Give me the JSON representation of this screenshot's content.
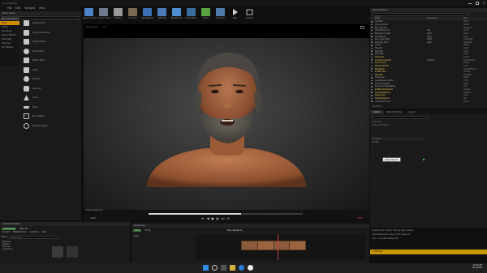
{
  "window": {
    "title": "UnrealEditor"
  },
  "menu": {
    "items": [
      "File",
      "Edit",
      "Window",
      "Help"
    ]
  },
  "toolbar": {
    "buttons": [
      {
        "label": "Save Current",
        "color": "#4a83c9"
      },
      {
        "label": "Source Control",
        "color": "#6d7a8a"
      },
      {
        "label": "Modes",
        "color": "#9a9a9a"
      },
      {
        "label": "Content",
        "color": "#7b6b52"
      },
      {
        "label": "Marketplace",
        "color": "#3b6fb4"
      },
      {
        "label": "Settings",
        "color": "#4c79b8"
      },
      {
        "label": "Blueprints",
        "color": "#4e8fd4"
      },
      {
        "label": "Cinematics",
        "color": "#3a6da0"
      },
      {
        "label": "Build",
        "color": "#5aa33f"
      },
      {
        "label": "Compile",
        "color": "#4d7aa8"
      },
      {
        "label": "Play",
        "color": "#cfcfcf"
      },
      {
        "label": "Launch",
        "color": "#bcbcbc"
      }
    ]
  },
  "place": {
    "tab_label": "Place Actors",
    "recently_placed": "Recently Placed",
    "categories": [
      "Basic",
      "Lights",
      "Cinematic",
      "Visual Effects",
      "Geometry",
      "Volumes",
      "All Classes"
    ],
    "items": [
      "Empty Actor",
      "Empty Character",
      "Empty Pawn",
      "Point Light",
      "Player Start",
      "Cube",
      "Sphere",
      "Cylinder",
      "Cone",
      "Plane",
      "Box Trigger",
      "Sphere Trigger"
    ]
  },
  "viewport": {
    "mode_label": "Perspective",
    "realtime_label": "Lit",
    "footer_label": "Shot_Sequence",
    "timecode_left": "0000",
    "timecode_right": "0000"
  },
  "outliner": {
    "tab_label": "World Outliner",
    "search_placeholder": "Search...",
    "headers": [
      "Label",
      "Sequencer",
      "Type"
    ],
    "rows": [
      {
        "label": "HeadRig",
        "seq": "",
        "type": "World",
        "color": ""
      },
      {
        "label": "Camera_Actor",
        "seq": "",
        "type": "Folder",
        "color": ""
      },
      {
        "label": "BP_Light_Rig",
        "seq": "",
        "type": "Blueprint",
        "color": ""
      },
      {
        "label": "Atmosphere_01",
        "seq": "Sky",
        "type": "Actor",
        "color": ""
      },
      {
        "label": "BackgroundLight",
        "seq": "Light",
        "type": "Actor",
        "color": ""
      },
      {
        "label": "FillLightLeft",
        "seq": "Light",
        "type": "Actor",
        "color": ""
      },
      {
        "label": "Key_Light_Right",
        "seq": "Light",
        "type": "PointLight",
        "color": ""
      },
      {
        "label": "RimLight_Back",
        "seq": "Light",
        "type": "RectLight",
        "color": ""
      },
      {
        "label": "Lights",
        "seq": "",
        "type": "Folder",
        "color": ""
      },
      {
        "label": "FillLight",
        "seq": "",
        "type": "Actor",
        "color": ""
      },
      {
        "label": "KeyLight",
        "seq": "",
        "type": "Actor",
        "color": ""
      },
      {
        "label": "RimLight",
        "seq": "",
        "type": "Actor",
        "color": ""
      },
      {
        "label": "Character",
        "seq": "",
        "type": "Folder",
        "color": "yellow"
      },
      {
        "label": "CineCameraActor",
        "seq": "Camera",
        "type": "CineCamera",
        "color": "yellow"
      },
      {
        "label": "FaceGrooms",
        "seq": "",
        "type": "Folder",
        "color": "yellow"
      },
      {
        "label": "HeadController",
        "seq": "",
        "type": "Actor",
        "color": "yellow"
      },
      {
        "label": "BodyMesh",
        "seq": "",
        "type": "SkeletalMesh",
        "color": "yellow"
      },
      {
        "label": "PostProcess",
        "seq": "",
        "type": "Volume",
        "color": "yellow"
      },
      {
        "label": "SkyLight",
        "seq": "",
        "type": "SkyLight",
        "color": "yellow"
      },
      {
        "label": "Sequencer",
        "seq": "",
        "type": "Folder",
        "color": ""
      },
      {
        "label": "LevelSequenceActor",
        "seq": "",
        "type": "Actor",
        "color": ""
      },
      {
        "label": "DirectionalLight",
        "seq": "",
        "type": "Light",
        "color": ""
      },
      {
        "label": "ExponentialHeightFog",
        "seq": "",
        "type": "Fog",
        "color": ""
      },
      {
        "label": "PostProcessVolume",
        "seq": "",
        "type": "Volume",
        "color": "yellow"
      },
      {
        "label": "SphereReflection",
        "seq": "",
        "type": "Capture",
        "color": "yellow"
      },
      {
        "label": "PlayerStart",
        "seq": "",
        "type": "Actor",
        "color": "yellow"
      },
      {
        "label": "SkyAtmosphere",
        "seq": "",
        "type": "Sky",
        "color": "yellow"
      },
      {
        "label": "VolumetricCloud",
        "seq": "",
        "type": "Cloud",
        "color": ""
      }
    ],
    "footer": "28 actors"
  },
  "details": {
    "tabs": [
      "Details",
      "World Settings",
      "Layers"
    ],
    "tooltip": "Select Parent",
    "label_rows": [
      "Actor Tags",
      "Component Name",
      "Transform"
    ],
    "sub_row": "Mobility"
  },
  "console": {
    "lines": [
      "LogStreaming: Display: Flushing async loaders",
      "LogLevelSequence: Playing Shot_Sequence",
      "Cmd: r.ScreenPercentage 100"
    ],
    "warning": "1 Warning"
  },
  "content_browser": {
    "tab_label": "Content Browser",
    "add_label": "Add/Import",
    "save_label": "Save All",
    "path": [
      "Content",
      "MetaHumans",
      "Common",
      "Face"
    ],
    "filter_label": "Filters",
    "search_placeholder": "Search Face",
    "folders": [
      "Materials",
      "Meshes",
      "Textures",
      "Animations"
    ]
  },
  "sequencer": {
    "tab_label": "Sequencer",
    "seq_name": "Shot_Sequence",
    "track_label": "Track",
    "fps": "24 fps",
    "timecode": "0000"
  },
  "taskbar": {
    "time": "10:24 AM",
    "date": "2/14/2024"
  },
  "colors": {
    "accent": "#d08a00",
    "warning": "#e6c24a",
    "panel": "#1a1a1a",
    "viewport_bg": "#000000"
  }
}
